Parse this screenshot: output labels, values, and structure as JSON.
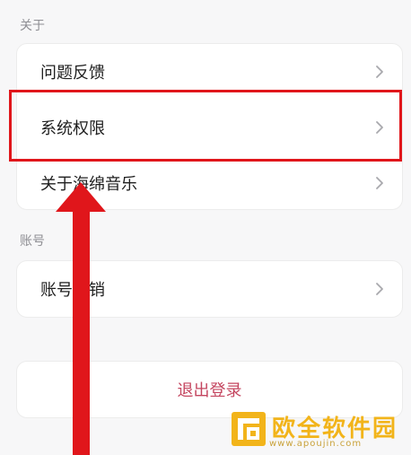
{
  "sections": {
    "about_label": "关于",
    "account_label": "账号"
  },
  "about_items": [
    {
      "label": "问题反馈"
    },
    {
      "label": "系统权限"
    },
    {
      "label": "关于海绵音乐"
    }
  ],
  "account_items": [
    {
      "label": "账号注销"
    }
  ],
  "logout": {
    "label": "退出登录",
    "color": "#c4455f"
  },
  "annotation": {
    "color": "#e0161b"
  },
  "watermark": {
    "text": "欧全软件园",
    "url": "www.apoujin.com",
    "color": "#f2b41a"
  },
  "icons": {
    "row_chevron": "chevron-right-icon",
    "watermark_logo": "logo-icon"
  }
}
